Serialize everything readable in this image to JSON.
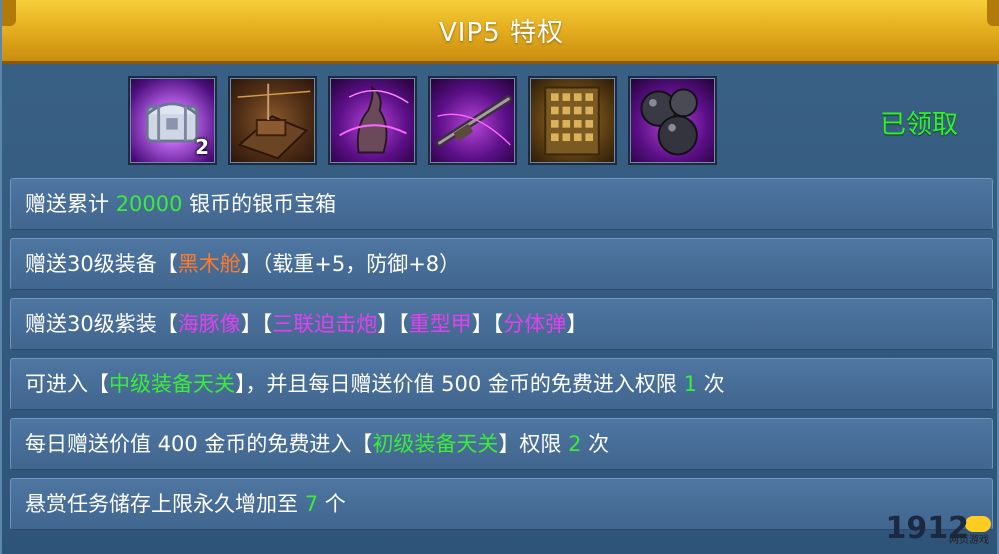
{
  "header": {
    "title": "VIP5 特权"
  },
  "rewards": {
    "items": [
      {
        "icon": "silver-chest-icon",
        "count": "2"
      },
      {
        "icon": "black-wood-ship-icon"
      },
      {
        "icon": "dolphin-figurehead-icon"
      },
      {
        "icon": "triple-mortar-cannon-icon"
      },
      {
        "icon": "heavy-armor-icon"
      },
      {
        "icon": "split-cannonball-icon"
      }
    ],
    "status": "已领取"
  },
  "rows": [
    {
      "parts": [
        "赠送累计 ",
        "20000",
        " 银币的银币宝箱"
      ]
    },
    {
      "parts": [
        "赠送30级装备【",
        "黑木舱",
        "】（载重+5，防御+8）"
      ]
    },
    {
      "parts": [
        "赠送30级紫装【",
        "海豚像",
        "】【",
        "三联迫击炮",
        "】【",
        "重型甲",
        "】【",
        "分体弹",
        "】"
      ]
    },
    {
      "parts": [
        "可进入【",
        "中级装备天关",
        "】，并且每日赠送价值 500 金币的免费进入权限 ",
        "1",
        " 次"
      ]
    },
    {
      "parts": [
        "每日赠送价值 400 金币的免费进入【",
        "初级装备天关",
        "】权限 ",
        "2",
        " 次"
      ]
    },
    {
      "parts": [
        "悬赏任务储存上限永久增加至 ",
        "7",
        " 个"
      ]
    }
  ],
  "watermark": {
    "logo": "1912",
    "badge": "yx",
    "sub": "网页游戏"
  },
  "colors": {
    "highlight_green": "#38ec38",
    "highlight_orange": "#ff7a2a",
    "highlight_purple": "#e33ff0",
    "header_gold": "#e6b01f"
  }
}
